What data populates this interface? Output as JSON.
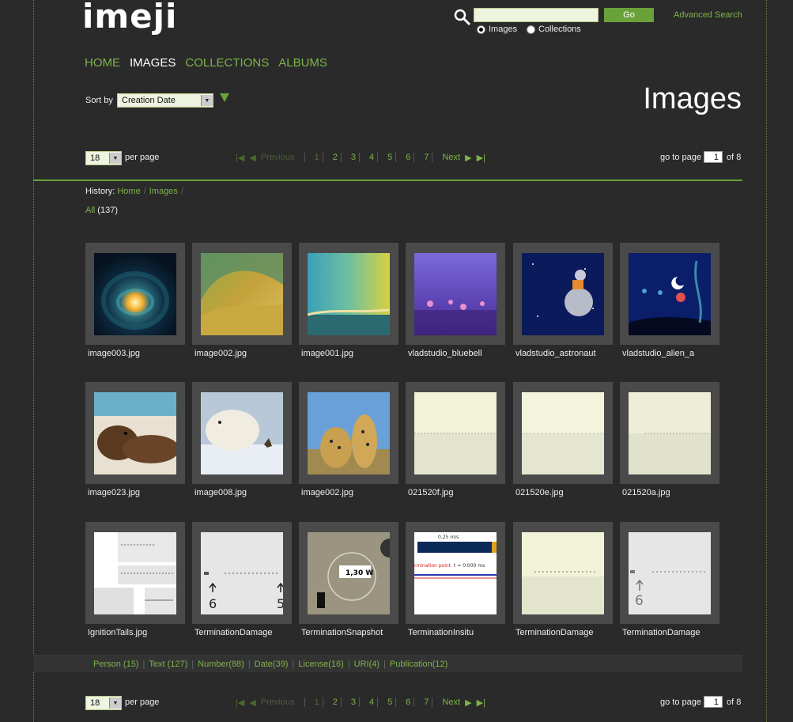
{
  "header": {
    "logo": "imeji",
    "search_value": "",
    "go_label": "Go",
    "advanced_search": "Advanced Search",
    "radio_images": "Images",
    "radio_collections": "Collections"
  },
  "nav": {
    "home": "HOME",
    "images": "IMAGES",
    "collections": "COLLECTIONS",
    "albums": "ALBUMS"
  },
  "sort": {
    "label": "Sort by",
    "value": "Creation Date"
  },
  "page_title": "Images",
  "pager": {
    "per_page_value": "18",
    "per_page_label": "per page",
    "previous": "Previous",
    "pages": [
      "1",
      "2",
      "3",
      "4",
      "5",
      "6",
      "7"
    ],
    "next": "Next",
    "goto_label": "go to page",
    "goto_value": "1",
    "of_label": "of 8"
  },
  "history": {
    "label": "History:",
    "home": "Home",
    "images": "Images"
  },
  "filter": {
    "all": "All",
    "count": "(137)"
  },
  "images": [
    {
      "name": "image003.jpg",
      "kind": "wave-tube"
    },
    {
      "name": "image002.jpg",
      "kind": "wave-gold"
    },
    {
      "name": "image001.jpg",
      "kind": "wave-green"
    },
    {
      "name": "vladstudio_bluebell",
      "kind": "bluebell"
    },
    {
      "name": "vladstudio_astronaut",
      "kind": "astronaut"
    },
    {
      "name": "vladstudio_alien_a",
      "kind": "alien"
    },
    {
      "name": "image023.jpg",
      "kind": "seals"
    },
    {
      "name": "image008.jpg",
      "kind": "polar-bear"
    },
    {
      "name": "image002.jpg",
      "kind": "cheetahs"
    },
    {
      "name": "021520f.jpg",
      "kind": "pale-1"
    },
    {
      "name": "021520e.jpg",
      "kind": "pale-2"
    },
    {
      "name": "021520a.jpg",
      "kind": "pale-3"
    },
    {
      "name": "IgnitionTails.jpg",
      "kind": "ignition"
    },
    {
      "name": "TerminationDamage",
      "kind": "termination-1"
    },
    {
      "name": "TerminationSnapshot",
      "kind": "snapshot"
    },
    {
      "name": "TerminationInsitu",
      "kind": "insitu"
    },
    {
      "name": "TerminationDamage",
      "kind": "termination-2"
    },
    {
      "name": "TerminationDamage",
      "kind": "termination-3"
    }
  ],
  "thumb_labels": {
    "snapshot_tag": "1,30 W",
    "insitu_speed": "0.25 m/s",
    "insitu_label": "rmination point",
    "insitu_t": "t = 0.000 ms",
    "termination_num_1": "6",
    "termination_num_2": "5",
    "termination_num_3": "6"
  },
  "facets": [
    "Person (15)",
    "Text (127)",
    "Number(88)",
    "Date(39)",
    "License(16)",
    "URI(4)",
    "Publication(12)"
  ],
  "colors": {
    "accent": "#7db44a",
    "button": "#6aa23a",
    "background": "#2a2a2a",
    "tile": "#4a4a4a"
  }
}
